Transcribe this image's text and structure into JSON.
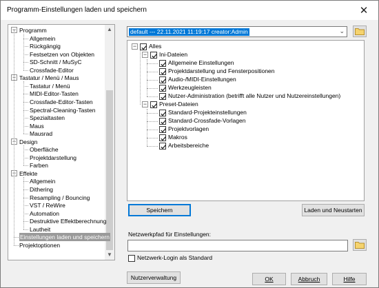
{
  "window": {
    "title": "Programm-Einstellungen laden und speichern",
    "close_glyph": "✕"
  },
  "nav": {
    "groups": [
      {
        "label": "Programm",
        "children": [
          "Allgemein",
          "Rückgängig",
          "Festsetzen von Objekten",
          "SD-Schnitt / MuSyC",
          "Crossfade-Editor"
        ]
      },
      {
        "label": "Tastatur / Menü / Maus",
        "children": [
          "Tastatur / Menü",
          "MIDI-Editor-Tasten",
          "Crossfade-Editor-Tasten",
          "Spectral-Cleaning-Tasten",
          "Spezialtasten",
          "Maus",
          "Mausrad"
        ]
      },
      {
        "label": "Design",
        "children": [
          "Oberfläche",
          "Projektdarstellung",
          "Farben"
        ]
      },
      {
        "label": "Effekte",
        "children": [
          "Allgemein",
          "Dithering",
          "Resampling / Bouncing",
          "VST / ReWire",
          "Automation",
          "Destruktive Effektberechnung",
          "Lautheit"
        ]
      }
    ],
    "selected_item": "Einstellungen laden und speichern",
    "last_item": "Projektoptionen"
  },
  "preset": {
    "value": "default --- 22.11.2021  11:19:17 creator:Admin"
  },
  "content_tree": {
    "root": "Alles",
    "ini_group": "Ini-Dateien",
    "ini_items": [
      "Allgemeine Einstellungen",
      "Projektdarstellung und Fensterpositionen",
      "Audio-/MIDI-Einstellungen",
      "Werkzeugleisten",
      "Nutzer-Administration (betrifft alle Nutzer und Nutzereinstellungen)"
    ],
    "preset_group": "Preset-Dateien",
    "preset_items": [
      "Standard-Projekteinstellungen",
      "Standard-Crossfade-Vorlagen",
      "Projektvorlagen",
      "Makros",
      "Arbeitsbereiche"
    ]
  },
  "buttons": {
    "save": "Speichern",
    "load_restart": "Laden und Neustarten",
    "user_admin": "Nutzerverwaltung",
    "ok": "OK",
    "cancel": "Abbruch",
    "help": "Hilfe"
  },
  "network": {
    "label": "Netzwerkpfad für Einstellungen:",
    "value": "",
    "login_default_label": "Netzwerk-Login als Standard"
  },
  "icons": {
    "folder": "folder-icon",
    "checkmark": "checkmark-icon"
  }
}
